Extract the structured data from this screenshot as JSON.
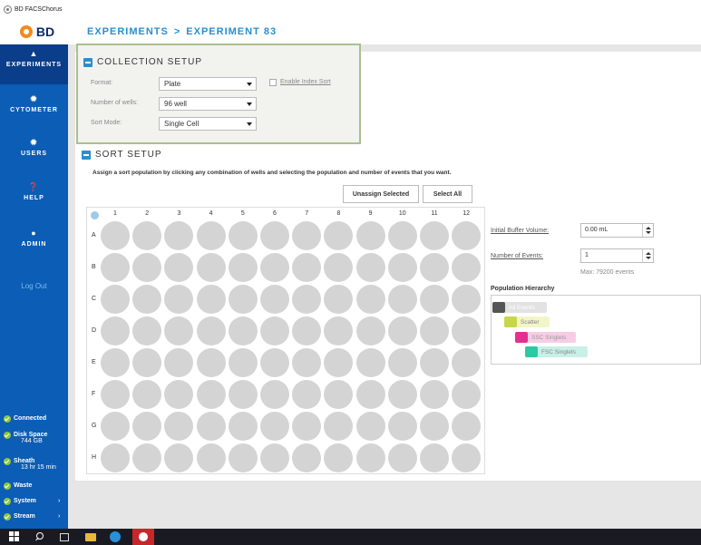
{
  "window": {
    "title": "BD FACSChorus"
  },
  "brand": {
    "logo_text": "BD",
    "logo_color": "#f28a1e"
  },
  "breadcrumb": {
    "section": "EXPERIMENTS",
    "separator": ">",
    "current": "EXPERIMENT 83"
  },
  "sidebar": {
    "items": [
      {
        "label": "EXPERIMENTS",
        "icon": "flask-icon",
        "active": true
      },
      {
        "label": "CYTOMETER",
        "icon": "gear-icon"
      },
      {
        "label": "USERS",
        "icon": "gear-icon"
      },
      {
        "label": "HELP",
        "icon": "question-icon"
      },
      {
        "label": "ADMIN",
        "icon": "person-icon"
      }
    ],
    "logout": "Log Out",
    "status": {
      "connected": "Connected",
      "disk_label": "Disk Space",
      "disk_value": "744 GB",
      "sheath_label": "Sheath",
      "sheath_value": "13 hr 15 min",
      "waste": "Waste",
      "system": "System",
      "stream": "Stream"
    }
  },
  "collection_setup": {
    "title": "COLLECTION SETUP",
    "format_label": "Format:",
    "format_value": "Plate",
    "wells_label": "Number of wells:",
    "wells_value": "96 well",
    "mode_label": "Sort Mode:",
    "mode_value": "Single Cell",
    "index_sort_label": "Enable Index Sort"
  },
  "sort_setup": {
    "title": "SORT SETUP",
    "instruction": "Assign a sort population by clicking any combination of wells and selecting the population and number of events that you want.",
    "unassign_button": "Unassign Selected",
    "select_all_button": "Select All",
    "columns": [
      "1",
      "2",
      "3",
      "4",
      "5",
      "6",
      "7",
      "8",
      "9",
      "10",
      "11",
      "12"
    ],
    "rows": [
      "A",
      "B",
      "C",
      "D",
      "E",
      "F",
      "G",
      "H"
    ]
  },
  "right_panel": {
    "buffer_label": "Initial Buffer Volume:",
    "buffer_value": "0.00 mL",
    "events_label": "Number of Events:",
    "events_value": "1",
    "max_events": "Max: 79200 events",
    "hierarchy_title": "Population Hierarchy",
    "populations": [
      {
        "name": "All Events",
        "color": "#555555"
      },
      {
        "name": "Scatter",
        "color": "#c9d64a"
      },
      {
        "name": "SSC Singlets",
        "color": "#e3308f"
      },
      {
        "name": "FSC Singlets",
        "color": "#2ec9a2"
      }
    ]
  },
  "colors": {
    "sidebar": "#0b5db5",
    "accent": "#2a8fcd",
    "highlight_border": "#a8c090"
  }
}
